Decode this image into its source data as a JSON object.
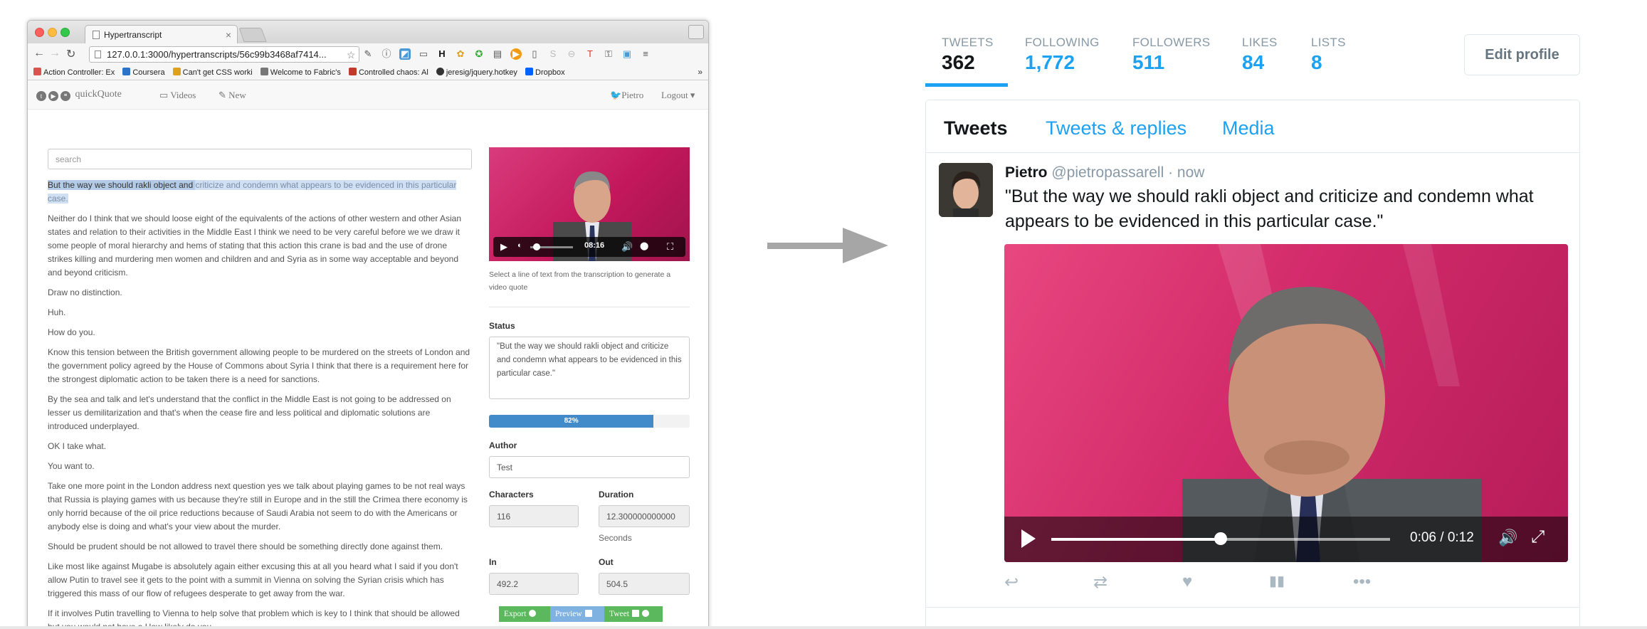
{
  "browser": {
    "tab_title": "Hypertranscript",
    "url": "127.0.0.1:3000/hypertranscripts/56c99b3468af7414...",
    "bookmarks": [
      "Action Controller: Ex",
      "Coursera",
      "Can't get CSS worki",
      "Welcome to Fabric's",
      "Controlled chaos: Al",
      "jeresig/jquery.hotkey",
      "Dropbox"
    ],
    "bookmark_more": "»",
    "bookmark_colors": [
      "#d9534f",
      "#2a73cc",
      "#e0a020",
      "#777777",
      "#c0392b",
      "#333333",
      "#0061fe"
    ]
  },
  "app": {
    "brand": "quickQuote",
    "nav_videos": "Videos",
    "nav_new": "New",
    "user": "Pietro",
    "logout": "Logout",
    "search_placeholder": "search",
    "transcript": {
      "selected_start": "But the way we should rakli object and ",
      "selected_rest": "criticize and condemn what appears to be evidenced in this particular case.",
      "paragraphs": [
        "Neither do I think that we should loose eight of the equivalents of the actions of other western and other Asian states and relation to their activities in the Middle East I think we need to be very careful before we we draw it some people of moral hierarchy and hems of stating that this action this crane is bad and the use of drone strikes killing and murdering men women and children and and Syria as in some way acceptable and beyond and beyond criticism.",
        "Draw no distinction.",
        "Huh.",
        "How do you.",
        "Know this tension between the British government allowing people to be murdered on the streets of London and the government policy agreed by the House of Commons about Syria I think that there is a requirement here for the strongest diplomatic action to be taken there is a need for sanctions.",
        "By the sea and talk and let's understand that the conflict in the Middle East is not going to be addressed on lesser us demilitarization and that's when the cease fire and less political and diplomatic solutions are introduced underplayed.",
        "OK I take what.",
        "You want to.",
        "Take one more point in the London address next question yes we talk about playing games to be not real ways that Russia is playing games with us because they're still in Europe and in the still the Crimea there economy is only horrid because of the oil price reductions because of Saudi Arabia not seem to do with the Americans or anybody else is doing and what's your view about the murder.",
        "Should be prudent should be not allowed to travel there should be something directly done against them.",
        "Like most like against Mugabe is absolutely again either excusing this at all you heard what I said if you don't allow Putin to travel see it gets to the point with a summit in Vienna on solving the Syrian crisis which has triggered this mass of our flow of refugees desperate to get away from the war.",
        "If it involves Putin travelling to Vienna to help solve that problem which is key to I think that should be allowed but you would not have a How likely do you."
      ]
    },
    "video_time": "08:16",
    "video_progress": 0.05,
    "caption": "Select a line of text from the transcription to generate a video quote",
    "status_label": "Status",
    "status_value": "\"But the way we should rakli object and criticize and condemn what appears to be evidenced in this particular case.\"",
    "progress_label": "82%",
    "progress_value": 0.82,
    "author_label": "Author",
    "author_value": "Test",
    "characters_label": "Characters",
    "characters_value": "116",
    "duration_label": "Duration",
    "duration_value": "12.300000000000",
    "duration_unit": "Seconds",
    "in_label": "In",
    "in_value": "492.2",
    "out_label": "Out",
    "out_value": "504.5",
    "btn_export": "Export",
    "btn_preview": "Preview",
    "btn_tweet": "Tweet"
  },
  "twitter": {
    "stats": [
      {
        "label": "TWEETS",
        "value": "362"
      },
      {
        "label": "FOLLOWING",
        "value": "1,772"
      },
      {
        "label": "FOLLOWERS",
        "value": "511"
      },
      {
        "label": "LIKES",
        "value": "84"
      },
      {
        "label": "LISTS",
        "value": "8"
      }
    ],
    "edit_profile": "Edit profile",
    "tabs": [
      "Tweets",
      "Tweets & replies",
      "Media"
    ],
    "tweet": {
      "name": "Pietro",
      "handle": "@pietropassarell",
      "time": "· now",
      "text": "\"But the way we should rakli object and criticize and condemn what appears to be evidenced in this particular case.\"",
      "video_time": "0:06 / 0:12",
      "video_progress": 0.5
    },
    "accent": "#1da1f2"
  }
}
